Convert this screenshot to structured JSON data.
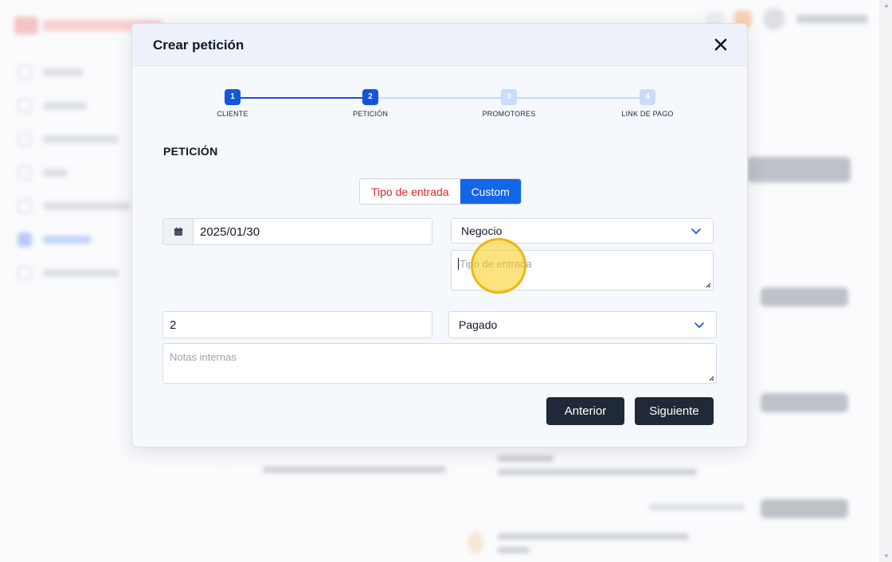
{
  "modal": {
    "title": "Crear petición",
    "close_icon": "close-icon"
  },
  "stepper": {
    "current_step": 2,
    "steps": [
      {
        "number": "1",
        "label": "CLIENTE",
        "state": "done"
      },
      {
        "number": "2",
        "label": "PETICIÓN",
        "state": "active"
      },
      {
        "number": "3",
        "label": "PROMOTORES",
        "state": "todo"
      },
      {
        "number": "4",
        "label": "LINK DE PAGO",
        "state": "todo"
      }
    ]
  },
  "section": {
    "title": "PETICIÓN"
  },
  "mode_toggle": {
    "options": [
      "Tipo de entrada",
      "Custom"
    ],
    "selected": "Custom"
  },
  "form": {
    "date": {
      "value": "2025/01/30",
      "icon": "calendar-icon"
    },
    "category_select": {
      "value": "Negocio"
    },
    "tipo_entrada": {
      "value": "",
      "placeholder": "Tipo de entrada"
    },
    "quantity": {
      "value": "2"
    },
    "payment_status_select": {
      "value": "Pagado"
    },
    "notas_internas": {
      "value": "",
      "placeholder": "Notas internas"
    }
  },
  "buttons": {
    "previous": "Anterior",
    "next": "Siguiente"
  },
  "colors": {
    "primary_blue": "#1366e8",
    "dark_button": "#1f2937",
    "toggle_off_text": "#dc2626",
    "step_inactive": "#c9dcfb",
    "brand_red": "#ef4444"
  }
}
